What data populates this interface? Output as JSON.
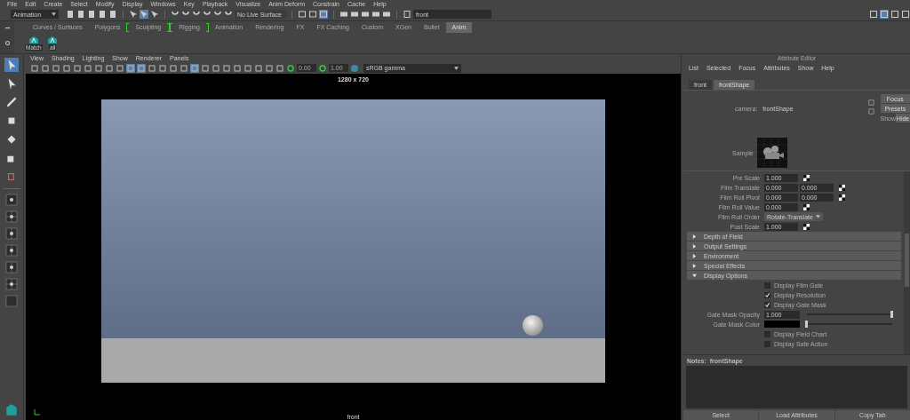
{
  "menubar": [
    "File",
    "Edit",
    "Create",
    "Select",
    "Modify",
    "Display",
    "Windows",
    "Key",
    "Playback",
    "Visualize",
    "Anim Deform",
    "Constrain",
    "Cache",
    "Help"
  ],
  "status_line": {
    "mode": "Animation",
    "live_surface": "No Live Surface",
    "search": "front"
  },
  "shelf": {
    "tabs": [
      {
        "label": "Curves / Surfaces",
        "selected": false,
        "bracketed": false
      },
      {
        "label": "Polygons",
        "selected": false,
        "bracketed": false
      },
      {
        "label": "Sculpting",
        "selected": false,
        "bracketed": true
      },
      {
        "label": "Rigging",
        "selected": false,
        "bracketed": true
      },
      {
        "label": "Animation",
        "selected": false,
        "bracketed": false
      },
      {
        "label": "Rendering",
        "selected": false,
        "bracketed": false
      },
      {
        "label": "FX",
        "selected": false,
        "bracketed": false
      },
      {
        "label": "FX Caching",
        "selected": false,
        "bracketed": false
      },
      {
        "label": "Custom",
        "selected": false,
        "bracketed": false
      },
      {
        "label": "XGen",
        "selected": false,
        "bracketed": false
      },
      {
        "label": "Bullet",
        "selected": false,
        "bracketed": false
      },
      {
        "label": "Anim",
        "selected": true,
        "bracketed": false
      }
    ],
    "items": [
      "Match",
      "all"
    ]
  },
  "viewport": {
    "menus": [
      "View",
      "Shading",
      "Lighting",
      "Show",
      "Renderer",
      "Panels"
    ],
    "exposure": "0.00",
    "gamma": "1.00",
    "color_space": "sRGB gamma",
    "resolution": "1280 x 720",
    "camera": "front"
  },
  "attribute_editor": {
    "title": "Attribute Editor",
    "menus": [
      "List",
      "Selected",
      "Focus",
      "Attributes",
      "Show",
      "Help"
    ],
    "tabs": [
      {
        "label": "front",
        "selected": false
      },
      {
        "label": "frontShape",
        "selected": true
      }
    ],
    "node_type": "camera:",
    "node_name": "frontShape",
    "buttons": [
      "Focus",
      "Presets"
    ],
    "show_hide": [
      {
        "label": "Show",
        "selected": false
      },
      {
        "label": "Hide",
        "selected": true
      }
    ],
    "sample_label": "Sample",
    "attributes": [
      {
        "kind": "numbers",
        "label": "Pre Scale",
        "values": [
          "1.000"
        ]
      },
      {
        "kind": "numbers",
        "label": "Film Translate",
        "values": [
          "0.000",
          "0.000"
        ]
      },
      {
        "kind": "numbers",
        "label": "Film Roll Pivot",
        "values": [
          "0.000",
          "0.000"
        ]
      },
      {
        "kind": "numbers",
        "label": "Film Roll Value",
        "values": [
          "0.000"
        ]
      },
      {
        "kind": "dropdown",
        "label": "Film Roll Order",
        "value": "Rotate-Translate"
      },
      {
        "kind": "numbers",
        "label": "Post Scale",
        "values": [
          "1.000"
        ]
      }
    ],
    "sections": [
      {
        "label": "Depth of Field",
        "expanded": false
      },
      {
        "label": "Output Settings",
        "expanded": false
      },
      {
        "label": "Environment",
        "expanded": false
      },
      {
        "label": "Special Effects",
        "expanded": false
      },
      {
        "label": "Display Options",
        "expanded": true,
        "rows": [
          {
            "kind": "checkbox",
            "label": "Display Film Gate",
            "checked": false
          },
          {
            "kind": "checkbox",
            "label": "Display Resolution",
            "checked": true
          },
          {
            "kind": "checkbox",
            "label": "Display Gate Mask",
            "checked": true
          },
          {
            "kind": "slider",
            "label": "Gate Mask Opacity",
            "value": "1.000",
            "level": 1
          },
          {
            "kind": "color",
            "label": "Gate Mask Color",
            "level": 0
          },
          {
            "kind": "checkbox",
            "label": "Display Field Chart",
            "checked": false
          },
          {
            "kind": "checkbox",
            "label": "Display Safe Action",
            "checked": false
          }
        ]
      }
    ],
    "notes_label": "Notes:",
    "notes_node": "frontShape",
    "bottom_buttons": [
      "Select",
      "Load Attributes",
      "Copy Tab"
    ]
  }
}
